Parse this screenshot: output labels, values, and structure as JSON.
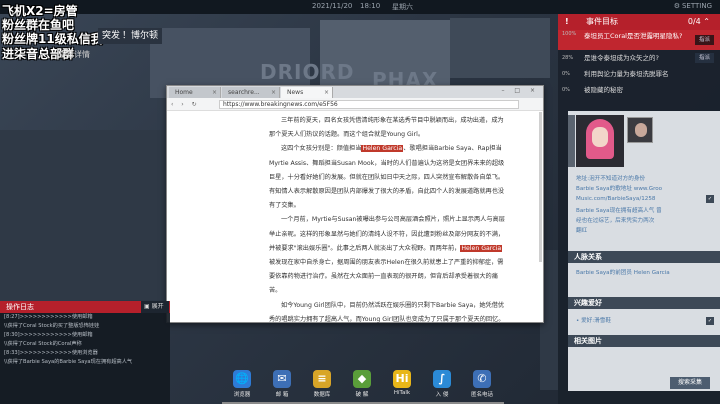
{
  "topbar": {
    "date": "2021/11/20",
    "time": "18:10",
    "weekday": "星期六",
    "settings": "SETTING"
  },
  "overlay": {
    "line1": "飞机X2=房管",
    "line2": "粉丝群在鱼吧",
    "line3": "粉丝牌11级私信我",
    "line4": "进柒音总部群",
    "badge_left": "突发",
    "badge_right": "博尔顿",
    "detail_link": "查看详情"
  },
  "map": {
    "label_driord": "DRIORD",
    "label_phax": "PHAX"
  },
  "browser": {
    "tabs": [
      "Home",
      "searchre...",
      "News"
    ],
    "url": "https://www.breakingnews.com/e5F56",
    "nav_icons": "‹ › ↻",
    "win_buttons": "– □ ×",
    "paragraphs": [
      [
        "三年前的夏天，四名女孩凭借清纯形象在某选秀节目中脱颖而出，成功出道，成为那个夏天人们热议的话题。而这个组合就是Young Girl。"
      ],
      [
        "这四个女孩分别是：颜值担当",
        "Helen Garcia",
        "、歌唱担当Barbie Saya、Rap担当Myrtie Assis、舞蹈担当Susan Mook，当时的人们普遍认为这将是女团界未来的超级巨星，十分看好她们的发展。但就在团队如日中天之际，四人突然宣布解散各自单飞。有知情人表示解散原因是团队内部爆发了很大的矛盾，自此四个人的发展道路就再也没有了交集。"
      ],
      [
        "一个月前，Myrtie与Susan被曝出参与公司高层酒会照片，照片上显示两人与高层举止亲昵。这样的形象显然与她们的清纯人设不符，因此遭到粉丝及部分网友的不满，并被要求\"滚出娱乐圈\"。此事之后两人就淡出了大众视野。而两年前，",
        "Helen Garcia",
        "被发现在家中自杀身亡，据周围的朋友表示Helen在很久前就患上了严重的抑郁症，需要依靠药物进行治疗。虽然在大众面前一直表现的很开朗，但背后却承受着很大的痛苦。"
      ],
      [
        "如今Young Girl团队中，目前仍然活跃在娱乐圈的只剩下Barbie Saya，她凭借优秀的唱跳实力拥有了超高人气，而Young Girl团队也变成为了只属于那个夏天的回忆。"
      ]
    ]
  },
  "log": {
    "title": "操作日志",
    "mini": "展开",
    "entries": [
      "[8:27]>>>>>>>>>>>>使用邮箱",
      "\\\\获得了Coral Stock的买了整版恐怖娃娃",
      "[8:30]>>>>>>>>>>>>使用邮箱",
      "\\\\获得了Coral Stock的Coral声称",
      "[8:33]>>>>>>>>>>>>使用浏览器",
      "\\\\获得了Barbie Saya的Barbie Saya现在拥有超高人气"
    ]
  },
  "events": {
    "title": "事件目标",
    "count": "0/4",
    "alert_icon": "!",
    "tasks": [
      {
        "pct": "100%",
        "text": "泰坦员工Coral是否泄露明星隐私?",
        "btn": "指派",
        "current": true
      },
      {
        "pct": "28%",
        "text": "是谁令泰坦成为众矢之的?",
        "btn": "指派",
        "current": false
      },
      {
        "pct": "0%",
        "text": "利用舆论力量为泰坦洗脱罪名",
        "btn": "",
        "current": false
      },
      {
        "pct": "0%",
        "text": "被隐藏的秘密",
        "btn": "",
        "current": false
      }
    ]
  },
  "dossier": {
    "side_label": "Barbie Saya",
    "lines": [
      "地址:泡开不知道对方的身份",
      "Barbie Saya的歌地址 www.Groo",
      "Music.com/BarbieSaya/1258",
      "Barbie Saya现在拥有超高人气 曾",
      "经也在过综艺，后来凭实力两次",
      "翻红"
    ],
    "section_people": "人脉关系",
    "people_line": "Barbie Saya的前团员 Helen Garcia",
    "section_hobby": "兴趣爱好",
    "hobby_line": "• 爱好:滑雪鞋",
    "section_photos": "相关图片",
    "search_btn": "搜索采集",
    "check": "✓"
  },
  "dock": [
    {
      "label": "浏览器",
      "icon": "🌐",
      "color": "#2e7bd6"
    },
    {
      "label": "邮 箱",
      "icon": "✉",
      "color": "#3d6fb6"
    },
    {
      "label": "数据库",
      "icon": "≡",
      "color": "#d8a528"
    },
    {
      "label": "破 解",
      "icon": "◆",
      "color": "#5a9e3a"
    },
    {
      "label": "HiTalk",
      "icon": "Hi",
      "color": "#e8b619"
    },
    {
      "label": "入 侵",
      "icon": "∫",
      "color": "#2b8ad6"
    },
    {
      "label": "匿名电话",
      "icon": "✆",
      "color": "#3d6fb6"
    }
  ]
}
